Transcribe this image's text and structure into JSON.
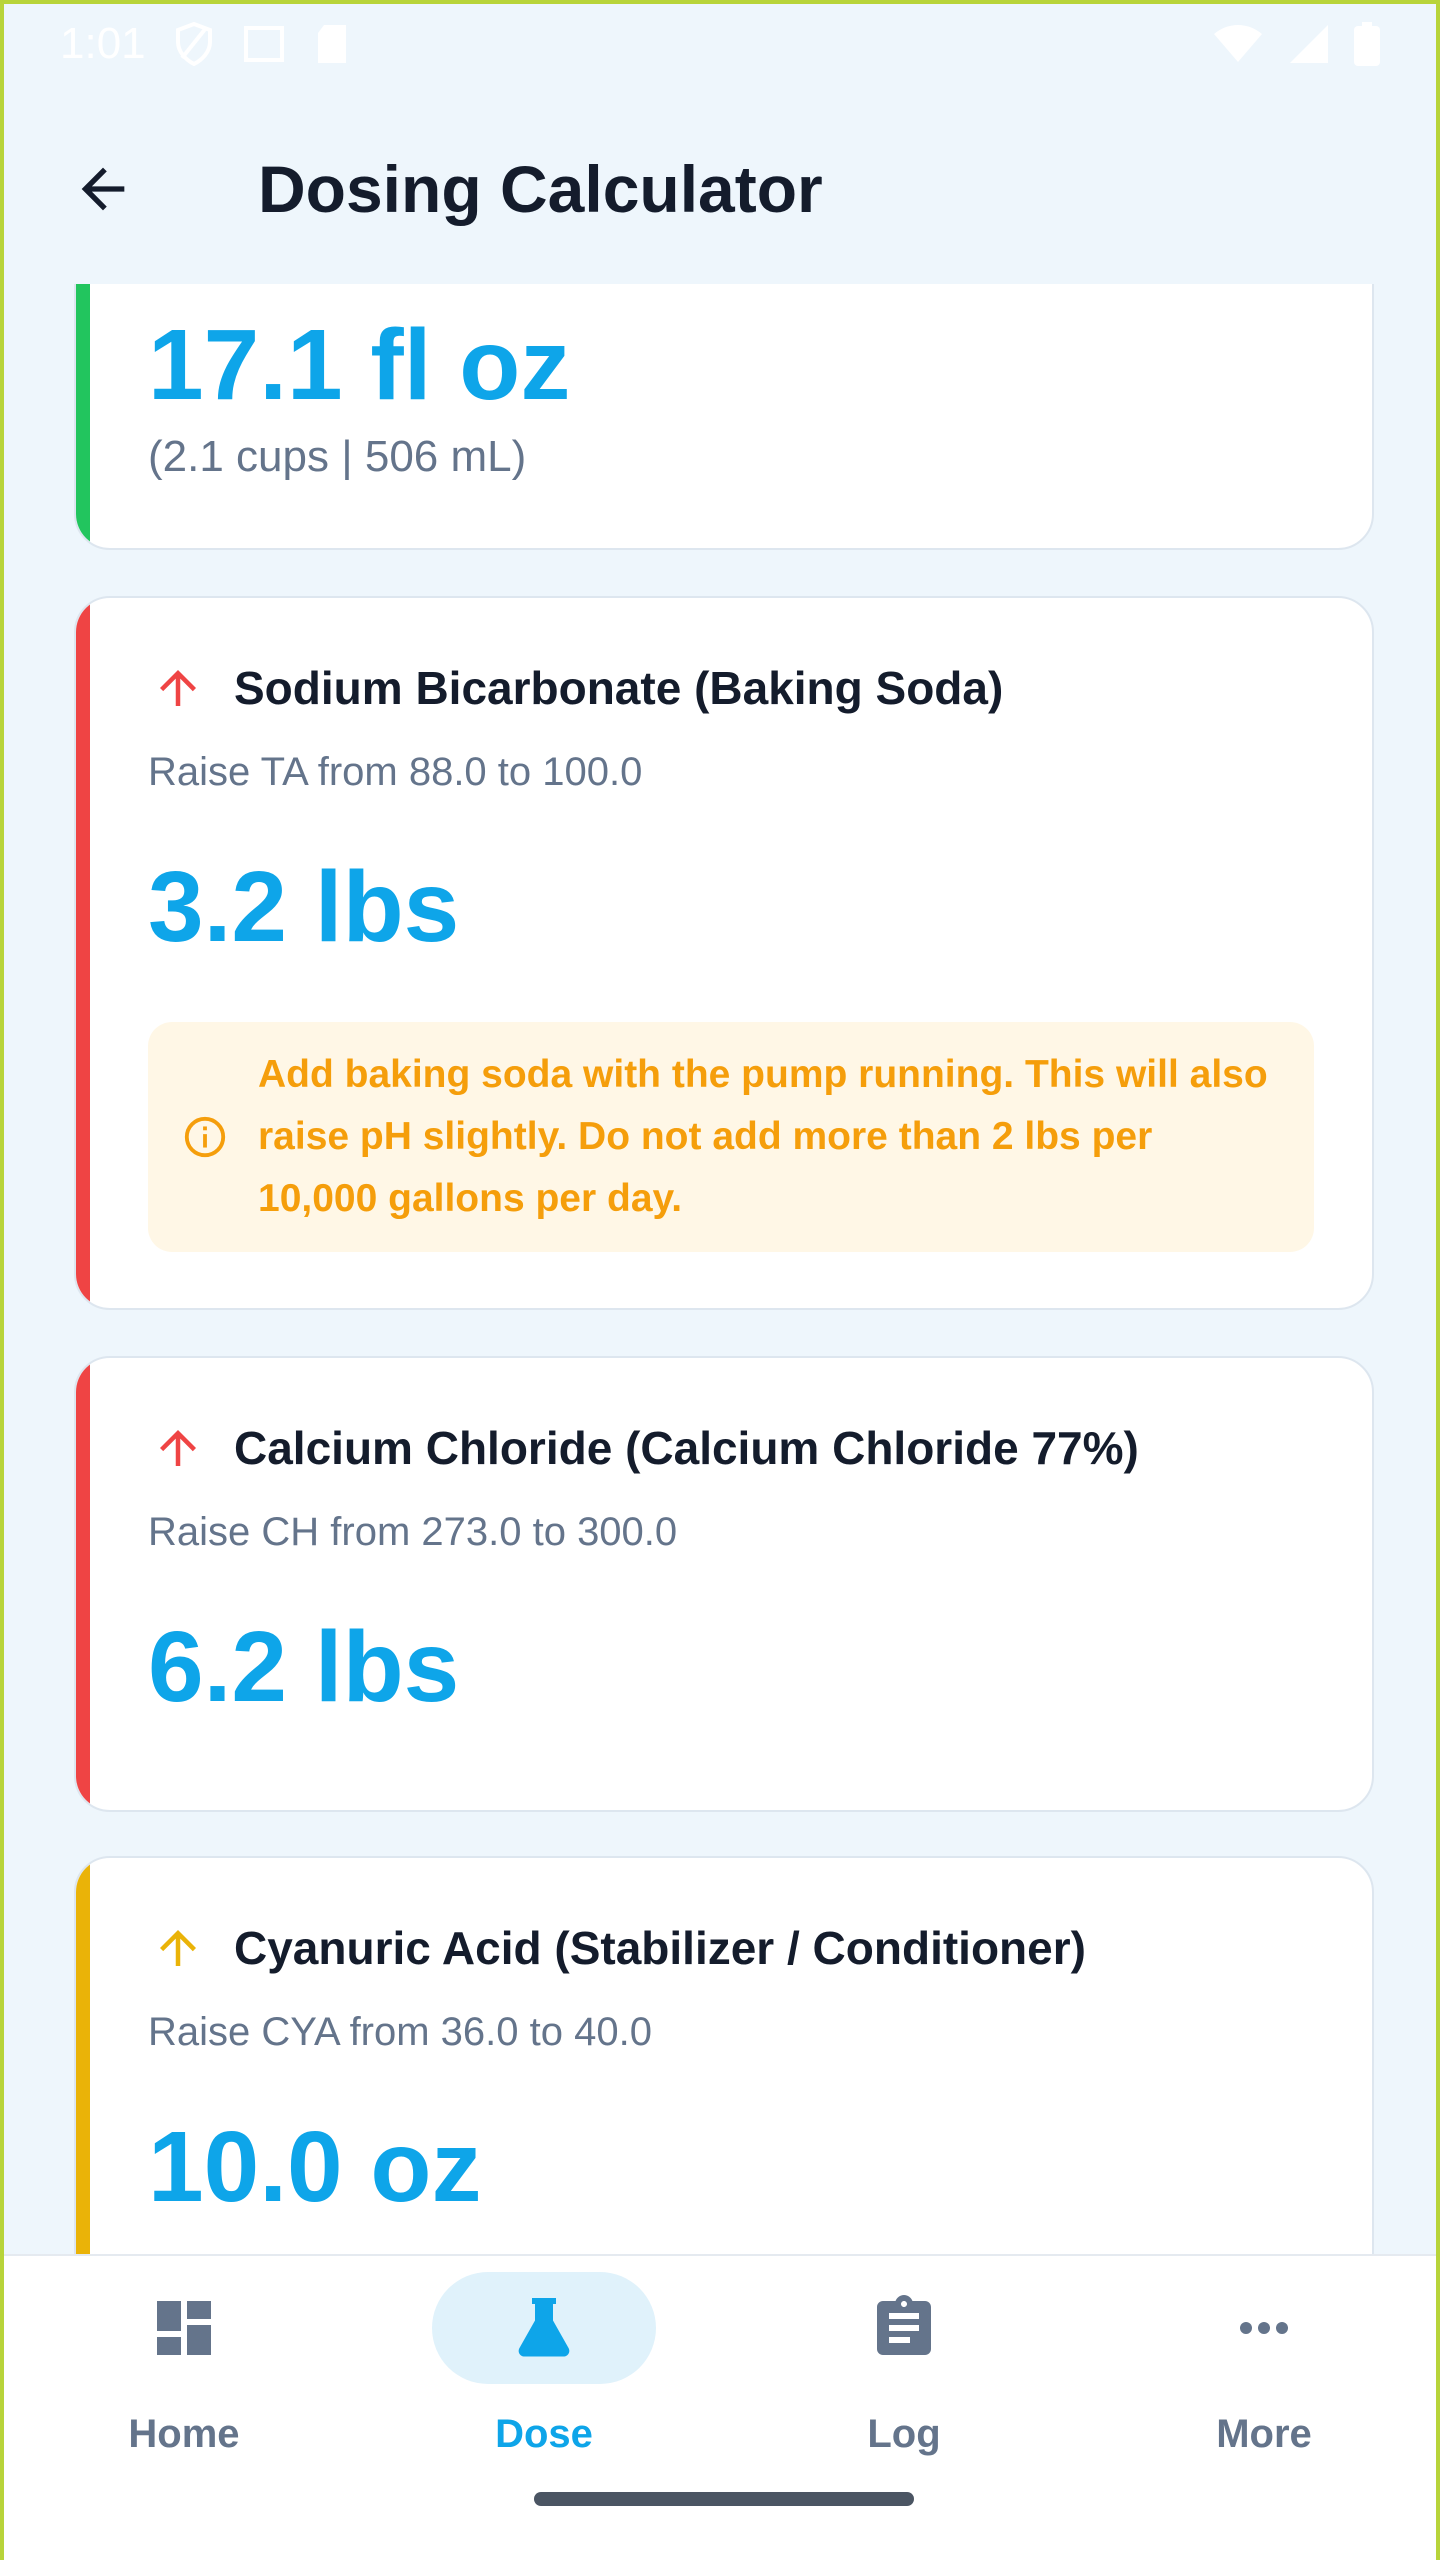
{
  "status_bar": {
    "time": "1:01",
    "icons": [
      "shield-icon",
      "screen-icon",
      "sdcard-icon",
      "wifi-icon",
      "signal-icon",
      "battery-icon"
    ]
  },
  "app_bar": {
    "title": "Dosing Calculator",
    "back_icon": "arrow-back-icon"
  },
  "cards": [
    {
      "accent_color": "#22c55e",
      "amount": "17.1 fl oz",
      "extra": "(2.1 cups | 506 mL)"
    },
    {
      "accent_color": "#ef4444",
      "arrow_color": "#ef4444",
      "arrow_icon": "arrow-up-icon",
      "title": "Sodium Bicarbonate (Baking Soda)",
      "subtitle": "Raise TA from 88.0 to 100.0",
      "amount": "3.2 lbs",
      "note": "Add baking soda with the pump running. This will also raise pH slightly. Do not add more than 2 lbs per 10,000 gallons per day.",
      "note_icon": "info-icon"
    },
    {
      "accent_color": "#ef4444",
      "arrow_color": "#ef4444",
      "arrow_icon": "arrow-up-icon",
      "title": "Calcium Chloride (Calcium Chloride 77%)",
      "subtitle": "Raise CH from 273.0 to 300.0",
      "amount": "6.2 lbs"
    },
    {
      "accent_color": "#eab308",
      "arrow_color": "#eab308",
      "arrow_icon": "arrow-up-icon",
      "title": "Cyanuric Acid (Stabilizer / Conditioner)",
      "subtitle": "Raise CYA from 36.0 to 40.0",
      "amount": "10.0 oz"
    }
  ],
  "bottom_nav": {
    "items": [
      {
        "label": "Home",
        "icon": "dashboard-icon",
        "active": false
      },
      {
        "label": "Dose",
        "icon": "flask-icon",
        "active": true
      },
      {
        "label": "Log",
        "icon": "clipboard-icon",
        "active": false
      },
      {
        "label": "More",
        "icon": "more-horiz-icon",
        "active": false
      }
    ]
  },
  "colors": {
    "accent": "#0ea5e9",
    "text_primary": "#141c2c",
    "text_secondary": "#64748b",
    "warning": "#f59e0b"
  }
}
